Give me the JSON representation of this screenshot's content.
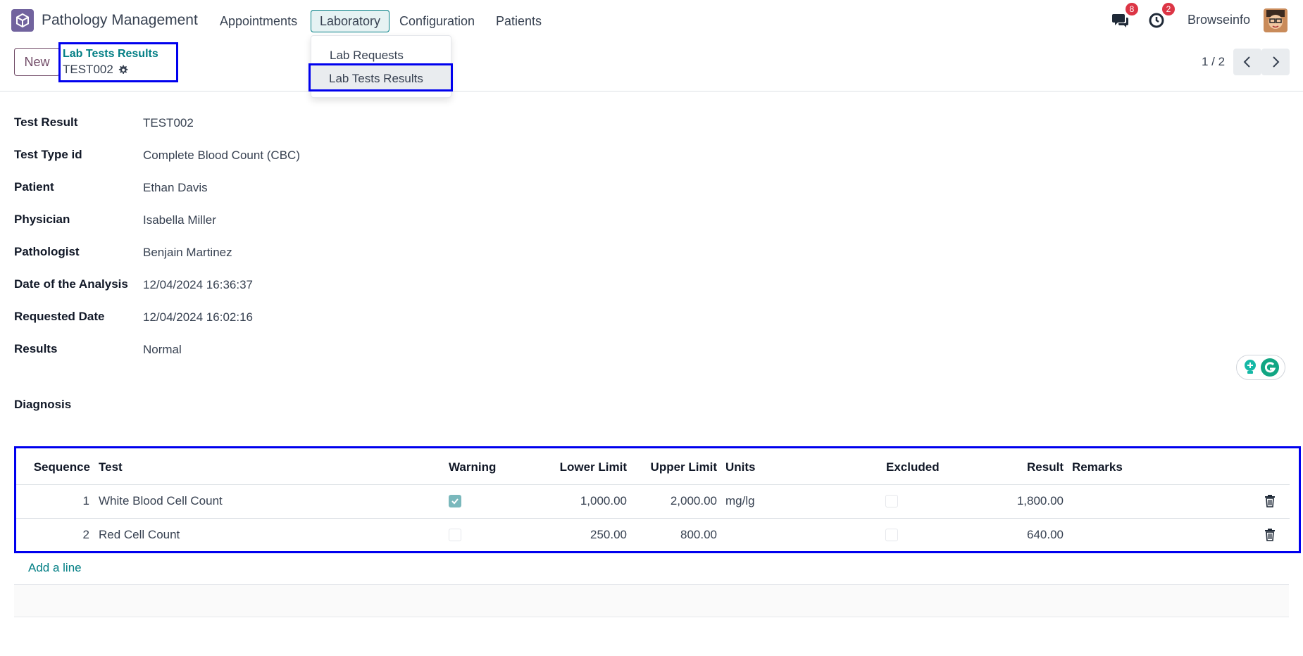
{
  "navbar": {
    "app_title": "Pathology Management",
    "menus": [
      "Appointments",
      "Laboratory",
      "Configuration",
      "Patients"
    ],
    "messages_count": "8",
    "activities_count": "2",
    "user_name": "Browseinfo"
  },
  "dropdown": {
    "items": [
      "Lab Requests",
      "Lab Tests Results"
    ]
  },
  "control": {
    "new_label": "New",
    "breadcrumb_link": "Lab Tests Results",
    "breadcrumb_current": "TEST002",
    "pager": "1 / 2"
  },
  "form": {
    "fields": [
      {
        "label": "Test Result",
        "value": "TEST002"
      },
      {
        "label": "Test Type id",
        "value": "Complete Blood Count (CBC)"
      },
      {
        "label": "Patient",
        "value": "Ethan Davis"
      },
      {
        "label": "Physician",
        "value": "Isabella Miller"
      },
      {
        "label": "Pathologist",
        "value": "Benjain Martinez"
      },
      {
        "label": "Date of the Analysis",
        "value": "12/04/2024 16:36:37"
      },
      {
        "label": "Requested Date",
        "value": "12/04/2024 16:02:16"
      },
      {
        "label": "Results",
        "value": "Normal"
      }
    ],
    "diagnosis_label": "Diagnosis"
  },
  "table": {
    "headers": {
      "sequence": "Sequence",
      "test": "Test",
      "warning": "Warning",
      "lower": "Lower Limit",
      "upper": "Upper Limit",
      "units": "Units",
      "excluded": "Excluded",
      "result": "Result",
      "remarks": "Remarks"
    },
    "rows": [
      {
        "sequence": "1",
        "test": "White Blood Cell Count",
        "warning": true,
        "lower": "1,000.00",
        "upper": "2,000.00",
        "units": "mg/lg",
        "excluded": false,
        "result": "1,800.00",
        "remarks": ""
      },
      {
        "sequence": "2",
        "test": "Red Cell Count",
        "warning": false,
        "lower": "250.00",
        "upper": "800.00",
        "units": "",
        "excluded": false,
        "result": "640.00",
        "remarks": ""
      }
    ],
    "add_line": "Add a line"
  },
  "colors": {
    "brand": "#714b67",
    "accent": "#017e84",
    "badge": "#dc3545",
    "highlight_box": "#0000ee"
  }
}
